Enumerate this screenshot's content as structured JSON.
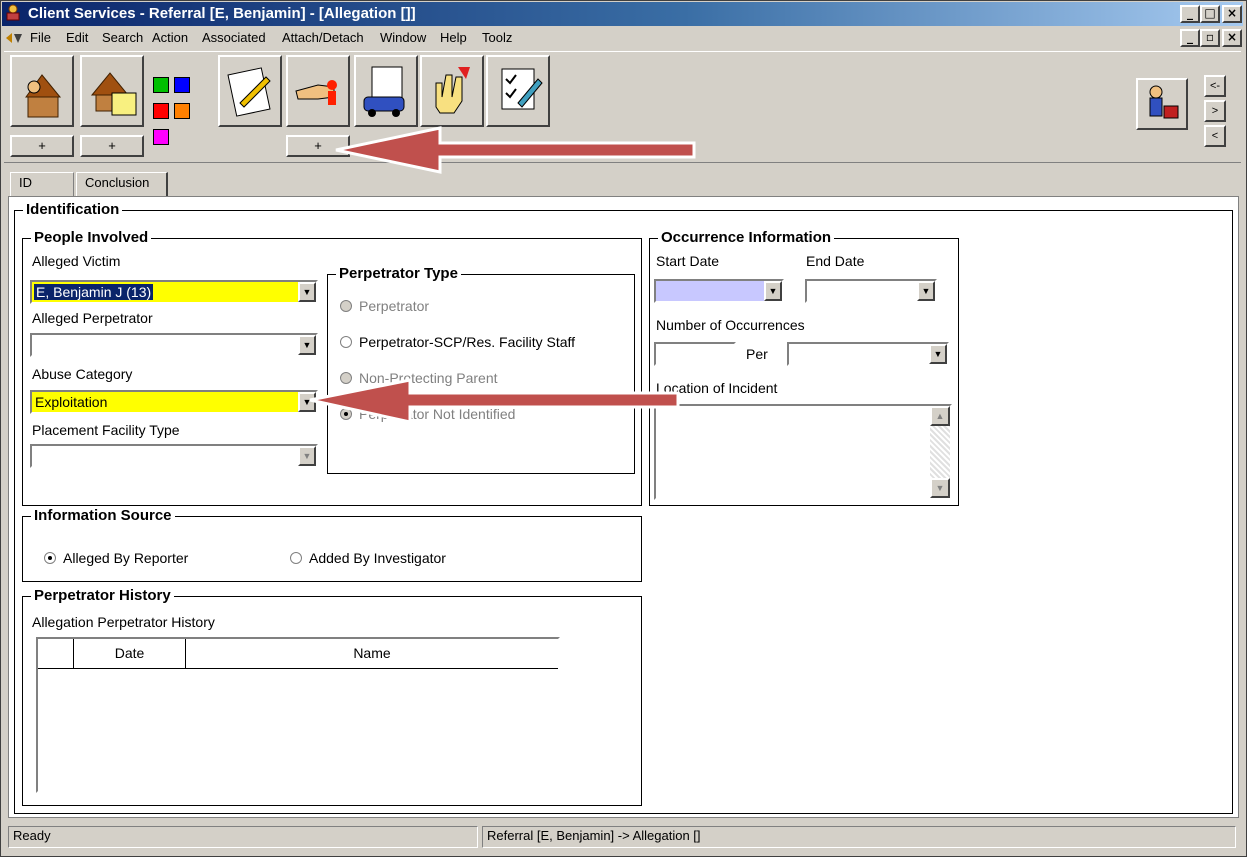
{
  "window": {
    "title": "Client Services - Referral [E, Benjamin] - [Allegation []]",
    "controls": {
      "minimize": "_",
      "maximize": "□",
      "close": "×"
    },
    "child_controls": {
      "minimize": "_",
      "restore": "▫",
      "close": "×"
    }
  },
  "menubar": {
    "items": [
      "File",
      "Edit",
      "Search",
      "Action",
      "Associated",
      "Attach/Detach",
      "Window",
      "Help",
      "Toolz"
    ]
  },
  "toolbar": {
    "plus_label": "+",
    "nav": {
      "back": "<-",
      "forward": ">",
      "prev": "<"
    },
    "swatch_colors": [
      "#00c000",
      "#0000ff",
      "#ff0000",
      "#ff8000",
      "#ff00ff"
    ]
  },
  "tabs": [
    "ID",
    "Conclusion"
  ],
  "identification": {
    "title": "Identification",
    "people": {
      "title": "People Involved",
      "alleged_victim_label": "Alleged Victim",
      "alleged_victim_value": "E, Benjamin J (13)",
      "alleged_perpetrator_label": "Alleged Perpetrator",
      "alleged_perpetrator_value": "",
      "abuse_category_label": "Abuse Category",
      "abuse_category_value": "Exploitation",
      "placement_facility_label": "Placement Facility Type",
      "placement_facility_value": ""
    },
    "perpetrator_type": {
      "title": "Perpetrator Type",
      "options": [
        "Perpetrator",
        "Perpetrator-SCP/Res. Facility Staff",
        "Non-Protecting Parent",
        "Perpetrator Not Identified"
      ],
      "selected_index": 3
    },
    "occurrence": {
      "title": "Occurrence Information",
      "start_date_label": "Start Date",
      "end_date_label": "End Date",
      "occurrences_label": "Number of Occurrences",
      "per_label": "Per",
      "location_label": "Location of Incident"
    },
    "information_source": {
      "title": "Information Source",
      "options": [
        "Alleged By Reporter",
        "Added By Investigator"
      ],
      "selected_index": 0
    },
    "perpetrator_history": {
      "title": "Perpetrator History",
      "subtitle": "Allegation Perpetrator History",
      "columns": [
        "Date",
        "Name"
      ]
    }
  },
  "statusbar": {
    "left": "Ready",
    "right": "Referral [E, Benjamin] -> Allegation []"
  },
  "annotation_color": "#c0504d"
}
